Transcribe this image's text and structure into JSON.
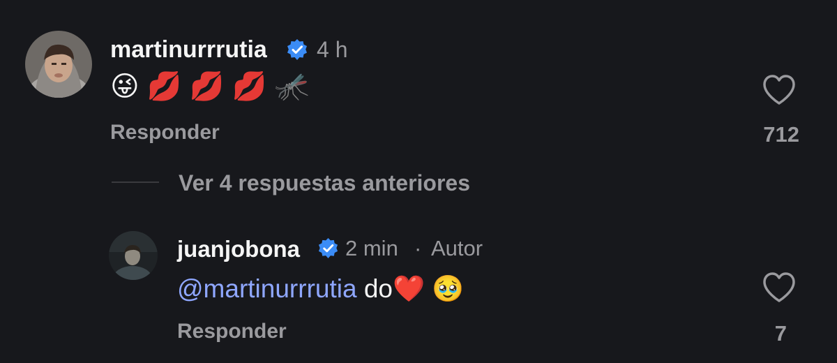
{
  "colors": {
    "background": "#17181c",
    "text": "#f5f5f5",
    "muted": "#9a9a9e",
    "verified": "#3b8cf6",
    "mention": "#8fa7ff"
  },
  "comment1": {
    "username": "martinurrrutia",
    "time": "4 h",
    "emojis": "😜 💋 💋 💋 🦟",
    "reply_label": "Responder",
    "like_count": "712",
    "avatar_icon": "profile-photo"
  },
  "view_replies_label": "Ver 4 respuestas anteriores",
  "comment2": {
    "username": "juanjobona",
    "time": "2 min",
    "separator": "·",
    "author_badge": "Autor",
    "mention": "@martinurrrutia",
    "text": " do",
    "emojis": "❤️ 🥹",
    "reply_label": "Responder",
    "like_count": "7",
    "avatar_icon": "profile-photo"
  }
}
